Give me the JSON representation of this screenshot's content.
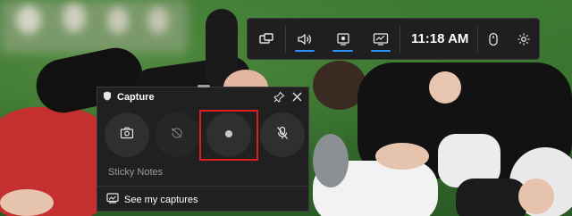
{
  "top_bar": {
    "clock": "11:18 AM",
    "buttons": [
      {
        "icon": "widget-menu-icon",
        "active": false
      },
      {
        "icon": "audio-icon",
        "active": true
      },
      {
        "icon": "capture-icon",
        "active": true
      },
      {
        "icon": "performance-icon",
        "active": true
      },
      {
        "icon": "mouse-icon",
        "active": false
      },
      {
        "icon": "settings-icon",
        "active": false
      }
    ],
    "accent": "#2b8fff"
  },
  "capture_widget": {
    "title": "Capture",
    "buttons": [
      {
        "icon": "screenshot-icon",
        "enabled": true
      },
      {
        "icon": "record-last-30s-icon",
        "enabled": false
      },
      {
        "icon": "start-recording-icon",
        "enabled": true,
        "highlighted": true
      },
      {
        "icon": "microphone-off-icon",
        "enabled": true
      }
    ],
    "sticky_notes_label": "Sticky Notes",
    "see_captures_label": "See my captures",
    "highlight_color": "#e01c1c"
  }
}
